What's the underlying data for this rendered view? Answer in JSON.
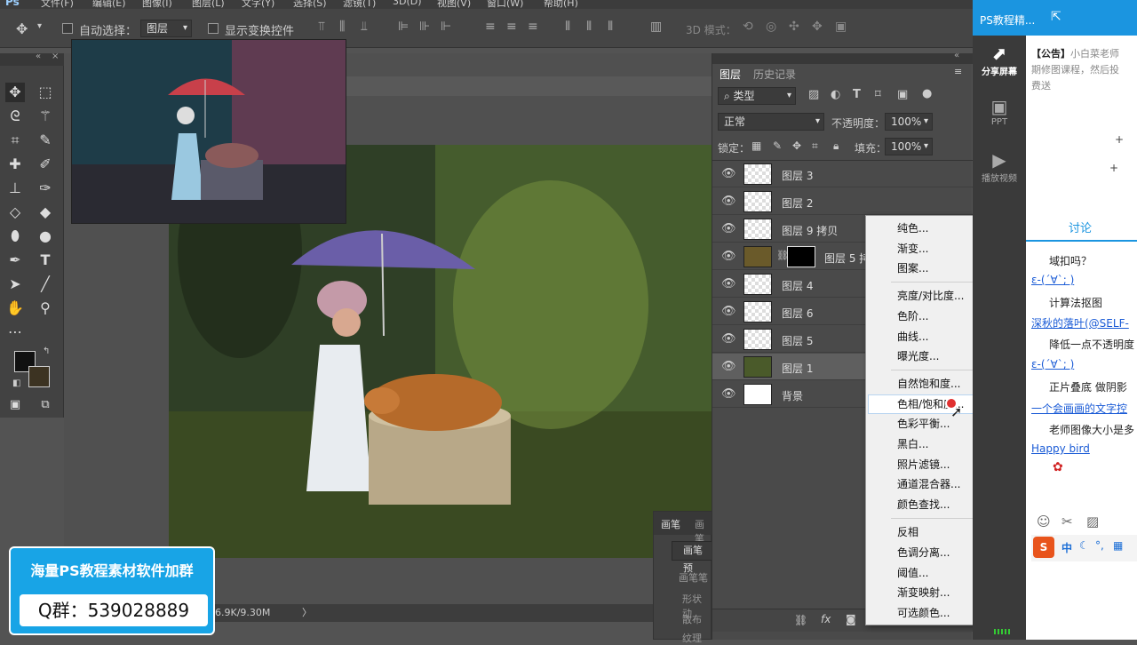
{
  "menubar": {
    "logo": "Ps",
    "items": [
      "文件(F)",
      "编辑(E)",
      "图像(I)",
      "图层(L)",
      "文字(Y)",
      "选择(S)",
      "滤镜(T)",
      "3D(D)",
      "视图(V)",
      "窗口(W)",
      "帮助(H)"
    ]
  },
  "options": {
    "auto_select_label": "自动选择：",
    "auto_select_value": "图层",
    "show_transform_label": "显示变换控件",
    "mode_3d_label": "3D 模式："
  },
  "layers_panel": {
    "tab_layers": "图层",
    "tab_history": "历史记录",
    "filter_type": "类型",
    "blend_mode": "正常",
    "opacity_label": "不透明度：",
    "opacity_value": "100%",
    "lock_label": "锁定：",
    "fill_label": "填充：",
    "fill_value": "100%",
    "layers": [
      {
        "name": "图层 3"
      },
      {
        "name": "图层 2"
      },
      {
        "name": "图层 9 拷贝"
      },
      {
        "name": "图层 5 拷"
      },
      {
        "name": "图层 4"
      },
      {
        "name": "图层 6"
      },
      {
        "name": "图层 5"
      },
      {
        "name": "图层 1"
      },
      {
        "name": "背景"
      }
    ]
  },
  "adjust_menu": {
    "group1": [
      "纯色...",
      "渐变...",
      "图案..."
    ],
    "group2": [
      "亮度/对比度...",
      "色阶...",
      "曲线...",
      "曝光度..."
    ],
    "group3": [
      "自然饱和度...",
      "色相/饱和度...",
      "色彩平衡...",
      "黑白...",
      "照片滤镜...",
      "通道混合器...",
      "颜色查找..."
    ],
    "group4": [
      "反相",
      "色调分离...",
      "阈值...",
      "渐变映射...",
      "可选颜色..."
    ],
    "highlighted": "色相/饱和度..."
  },
  "brush_panel": {
    "tab1": "画笔",
    "tab2": "画笔",
    "preset_btn": "画笔预",
    "items": [
      "画笔笔",
      "形状动",
      "散布",
      "纹理"
    ]
  },
  "status": {
    "doc_size": "6.9K/9.30M"
  },
  "ad": {
    "line1": "海量PS教程素材软件加群",
    "line2": "Q群：539028889"
  },
  "chat": {
    "title": "PS教程精...",
    "rail": [
      "分享屏幕",
      "PPT",
      "播放视频"
    ],
    "notice_tag": "【公告】",
    "notice_text": "小白菜老师",
    "notice_l2": "期修图课程，然后投",
    "notice_l3": "费送",
    "discuss_tab": "讨论",
    "messages": [
      {
        "text": "域扣吗？",
        "link": false
      },
      {
        "text": "ε-(´∀`; )",
        "link": true
      },
      {
        "text": "计算法抠图",
        "link": false
      },
      {
        "text": "深秋的落叶(@SELF-",
        "link": true
      },
      {
        "text": "降低一点不透明度",
        "link": false
      },
      {
        "text": "ε-(´∀`; )",
        "link": true
      },
      {
        "text": "正片叠底 做阴影",
        "link": false
      },
      {
        "text": "一个会画画的文字控",
        "link": true
      },
      {
        "text": "老师图像大小是多",
        "link": false
      },
      {
        "text": "Happy bird",
        "link": true
      }
    ],
    "ime_label": "中"
  },
  "colors": {
    "accent": "#1b95e0",
    "panel": "#4a4a4a",
    "menu_bg": "#f0f0f0"
  }
}
